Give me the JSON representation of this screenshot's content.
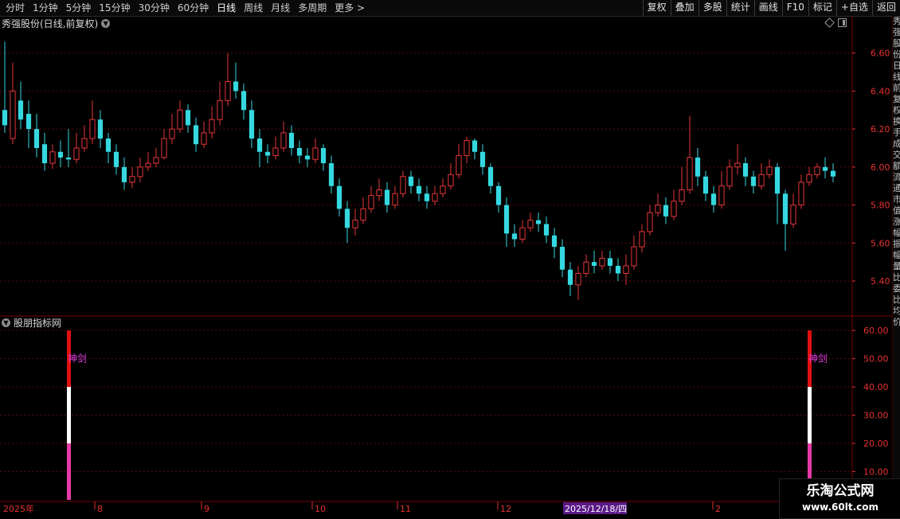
{
  "toolbar": {
    "periods": [
      "分时",
      "1分钟",
      "5分钟",
      "15分钟",
      "30分钟",
      "60分钟",
      "日线",
      "周线",
      "月线",
      "多周期"
    ],
    "active_period": "日线",
    "more_label": "更多 >",
    "right_buttons": [
      "复权",
      "叠加",
      "多股",
      "统计",
      "画线",
      "F10",
      "标记",
      "+自选",
      "返回"
    ]
  },
  "main_panel": {
    "title": "秀强股份(日线,前复权)",
    "chevron_icon": "chevron-down-icon"
  },
  "sub_panel": {
    "title": "股朋指标网",
    "signal_label": "神剑"
  },
  "date_axis": {
    "labels": [
      "2025年",
      "8",
      "9",
      "10",
      "11",
      "12",
      "2"
    ],
    "highlight": "2025/12/18/四"
  },
  "right_strip_text": "秀强股份日线前复权换手成交额流通市值涨幅振幅量比委比均价",
  "watermark": {
    "title": "乐淘公式网",
    "url": "www.60lt.com"
  },
  "colors": {
    "up": "#e4363a",
    "down": "#35d8e0",
    "grid": "#5a0a0a",
    "axis_text": "#e63030",
    "signal_red": "#e01010",
    "signal_white": "#ffffff",
    "signal_magenta": "#e63aa8",
    "label_magenta": "#e23ee0",
    "highlight_bg": "#5a1a88"
  },
  "chart_data": [
    {
      "type": "candlestick",
      "title": "秀强股份(日线,前复权)",
      "ylim": [
        5.22,
        6.72
      ],
      "yticks": [
        "6.60",
        "6.40",
        "6.20",
        "6.00",
        "5.80",
        "5.60",
        "5.40"
      ],
      "candles": [
        [
          6.3,
          6.22,
          6.66,
          6.18
        ],
        [
          6.15,
          6.4,
          6.55,
          6.12
        ],
        [
          6.35,
          6.25,
          6.45,
          6.2
        ],
        [
          6.28,
          6.2,
          6.35,
          6.1
        ],
        [
          6.2,
          6.1,
          6.28,
          6.05
        ],
        [
          6.12,
          6.02,
          6.18,
          5.98
        ],
        [
          6.02,
          6.08,
          6.12,
          5.99
        ],
        [
          6.08,
          6.05,
          6.14,
          6.0
        ],
        [
          6.05,
          6.04,
          6.2,
          6.0
        ],
        [
          6.04,
          6.1,
          6.18,
          6.02
        ],
        [
          6.1,
          6.15,
          6.22,
          6.08
        ],
        [
          6.15,
          6.25,
          6.35,
          6.12
        ],
        [
          6.25,
          6.15,
          6.3,
          6.1
        ],
        [
          6.15,
          6.08,
          6.18,
          6.02
        ],
        [
          6.08,
          6.0,
          6.12,
          5.96
        ],
        [
          6.0,
          5.92,
          6.05,
          5.88
        ],
        [
          5.92,
          5.95,
          6.0,
          5.89
        ],
        [
          5.95,
          6.0,
          6.05,
          5.92
        ],
        [
          6.0,
          6.02,
          6.08,
          5.98
        ],
        [
          6.02,
          6.05,
          6.1,
          6.0
        ],
        [
          6.05,
          6.15,
          6.2,
          6.04
        ],
        [
          6.15,
          6.2,
          6.28,
          6.12
        ],
        [
          6.2,
          6.3,
          6.35,
          6.18
        ],
        [
          6.3,
          6.22,
          6.33,
          6.18
        ],
        [
          6.22,
          6.12,
          6.26,
          6.08
        ],
        [
          6.12,
          6.18,
          6.24,
          6.1
        ],
        [
          6.18,
          6.25,
          6.32,
          6.15
        ],
        [
          6.25,
          6.35,
          6.45,
          6.22
        ],
        [
          6.35,
          6.45,
          6.6,
          6.32
        ],
        [
          6.45,
          6.4,
          6.55,
          6.36
        ],
        [
          6.4,
          6.3,
          6.44,
          6.25
        ],
        [
          6.3,
          6.15,
          6.35,
          6.1
        ],
        [
          6.15,
          6.08,
          6.2,
          6.0
        ],
        [
          6.08,
          6.06,
          6.12,
          6.02
        ],
        [
          6.06,
          6.1,
          6.16,
          6.04
        ],
        [
          6.1,
          6.18,
          6.24,
          6.08
        ],
        [
          6.18,
          6.1,
          6.22,
          6.06
        ],
        [
          6.1,
          6.06,
          6.14,
          6.02
        ],
        [
          6.06,
          6.04,
          6.1,
          6.0
        ],
        [
          6.04,
          6.1,
          6.15,
          6.02
        ],
        [
          6.1,
          6.02,
          6.12,
          5.98
        ],
        [
          6.02,
          5.9,
          6.06,
          5.86
        ],
        [
          5.9,
          5.78,
          5.94,
          5.74
        ],
        [
          5.78,
          5.68,
          5.82,
          5.6
        ],
        [
          5.68,
          5.72,
          5.78,
          5.64
        ],
        [
          5.72,
          5.78,
          5.84,
          5.7
        ],
        [
          5.78,
          5.85,
          5.9,
          5.76
        ],
        [
          5.85,
          5.88,
          5.94,
          5.82
        ],
        [
          5.88,
          5.8,
          5.92,
          5.76
        ],
        [
          5.8,
          5.86,
          5.9,
          5.78
        ],
        [
          5.86,
          5.95,
          5.98,
          5.84
        ],
        [
          5.95,
          5.9,
          5.98,
          5.86
        ],
        [
          5.9,
          5.86,
          5.94,
          5.82
        ],
        [
          5.86,
          5.82,
          5.9,
          5.78
        ],
        [
          5.82,
          5.86,
          5.9,
          5.8
        ],
        [
          5.86,
          5.9,
          5.94,
          5.84
        ],
        [
          5.9,
          5.96,
          6.02,
          5.88
        ],
        [
          5.96,
          6.06,
          6.12,
          5.94
        ],
        [
          6.06,
          6.14,
          6.16,
          6.02
        ],
        [
          6.14,
          6.08,
          6.15,
          6.04
        ],
        [
          6.08,
          6.0,
          6.12,
          5.96
        ],
        [
          6.0,
          5.9,
          6.02,
          5.86
        ],
        [
          5.9,
          5.8,
          5.92,
          5.76
        ],
        [
          5.8,
          5.65,
          5.84,
          5.58
        ],
        [
          5.65,
          5.62,
          5.7,
          5.58
        ],
        [
          5.62,
          5.68,
          5.72,
          5.6
        ],
        [
          5.68,
          5.72,
          5.76,
          5.66
        ],
        [
          5.72,
          5.7,
          5.76,
          5.66
        ],
        [
          5.7,
          5.64,
          5.74,
          5.6
        ],
        [
          5.64,
          5.58,
          5.68,
          5.52
        ],
        [
          5.58,
          5.46,
          5.62,
          5.42
        ],
        [
          5.46,
          5.38,
          5.5,
          5.32
        ],
        [
          5.38,
          5.44,
          5.48,
          5.3
        ],
        [
          5.44,
          5.5,
          5.54,
          5.42
        ],
        [
          5.5,
          5.48,
          5.56,
          5.44
        ],
        [
          5.48,
          5.52,
          5.56,
          5.46
        ],
        [
          5.52,
          5.48,
          5.56,
          5.44
        ],
        [
          5.48,
          5.44,
          5.52,
          5.4
        ],
        [
          5.44,
          5.48,
          5.54,
          5.38
        ],
        [
          5.48,
          5.58,
          5.64,
          5.46
        ],
        [
          5.58,
          5.66,
          5.7,
          5.55
        ],
        [
          5.66,
          5.76,
          5.8,
          5.64
        ],
        [
          5.76,
          5.8,
          5.86,
          5.74
        ],
        [
          5.8,
          5.74,
          5.84,
          5.7
        ],
        [
          5.74,
          5.82,
          5.88,
          5.72
        ],
        [
          5.82,
          5.88,
          6.0,
          5.8
        ],
        [
          5.88,
          6.05,
          6.27,
          5.86
        ],
        [
          6.05,
          5.95,
          6.1,
          5.9
        ],
        [
          5.95,
          5.86,
          5.98,
          5.82
        ],
        [
          5.86,
          5.8,
          5.9,
          5.76
        ],
        [
          5.8,
          5.9,
          5.98,
          5.78
        ],
        [
          5.9,
          6.0,
          6.04,
          5.88
        ],
        [
          6.0,
          6.02,
          6.12,
          5.96
        ],
        [
          6.02,
          5.95,
          6.05,
          5.9
        ],
        [
          5.95,
          5.9,
          5.98,
          5.86
        ],
        [
          5.9,
          5.96,
          6.02,
          5.88
        ],
        [
          5.96,
          6.0,
          6.04,
          5.94
        ],
        [
          6.0,
          5.86,
          6.02,
          5.7
        ],
        [
          5.86,
          5.7,
          5.88,
          5.56
        ],
        [
          5.7,
          5.8,
          5.86,
          5.68
        ],
        [
          5.8,
          5.92,
          5.96,
          5.78
        ],
        [
          5.92,
          5.96,
          6.0,
          5.9
        ],
        [
          5.96,
          6.0,
          6.02,
          5.94
        ],
        [
          6.0,
          5.98,
          6.05,
          5.94
        ],
        [
          5.98,
          5.95,
          6.02,
          5.92
        ]
      ]
    },
    {
      "type": "bar",
      "title": "股朋指标网",
      "ylim": [
        0,
        62
      ],
      "yticks": [
        "60.00",
        "50.00",
        "40.00",
        "30.00",
        "20.00",
        "10.00"
      ],
      "signals": [
        {
          "date_index": 8,
          "label": "神剑",
          "segments": [
            {
              "from": 0,
              "to": 20
            },
            {
              "from": 20,
              "to": 40
            },
            {
              "from": 40,
              "to": 60
            }
          ]
        },
        {
          "date_index": 101,
          "label": "神剑",
          "segments": [
            {
              "from": 0,
              "to": 20
            },
            {
              "from": 20,
              "to": 40
            },
            {
              "from": 40,
              "to": 60
            }
          ]
        }
      ]
    }
  ]
}
